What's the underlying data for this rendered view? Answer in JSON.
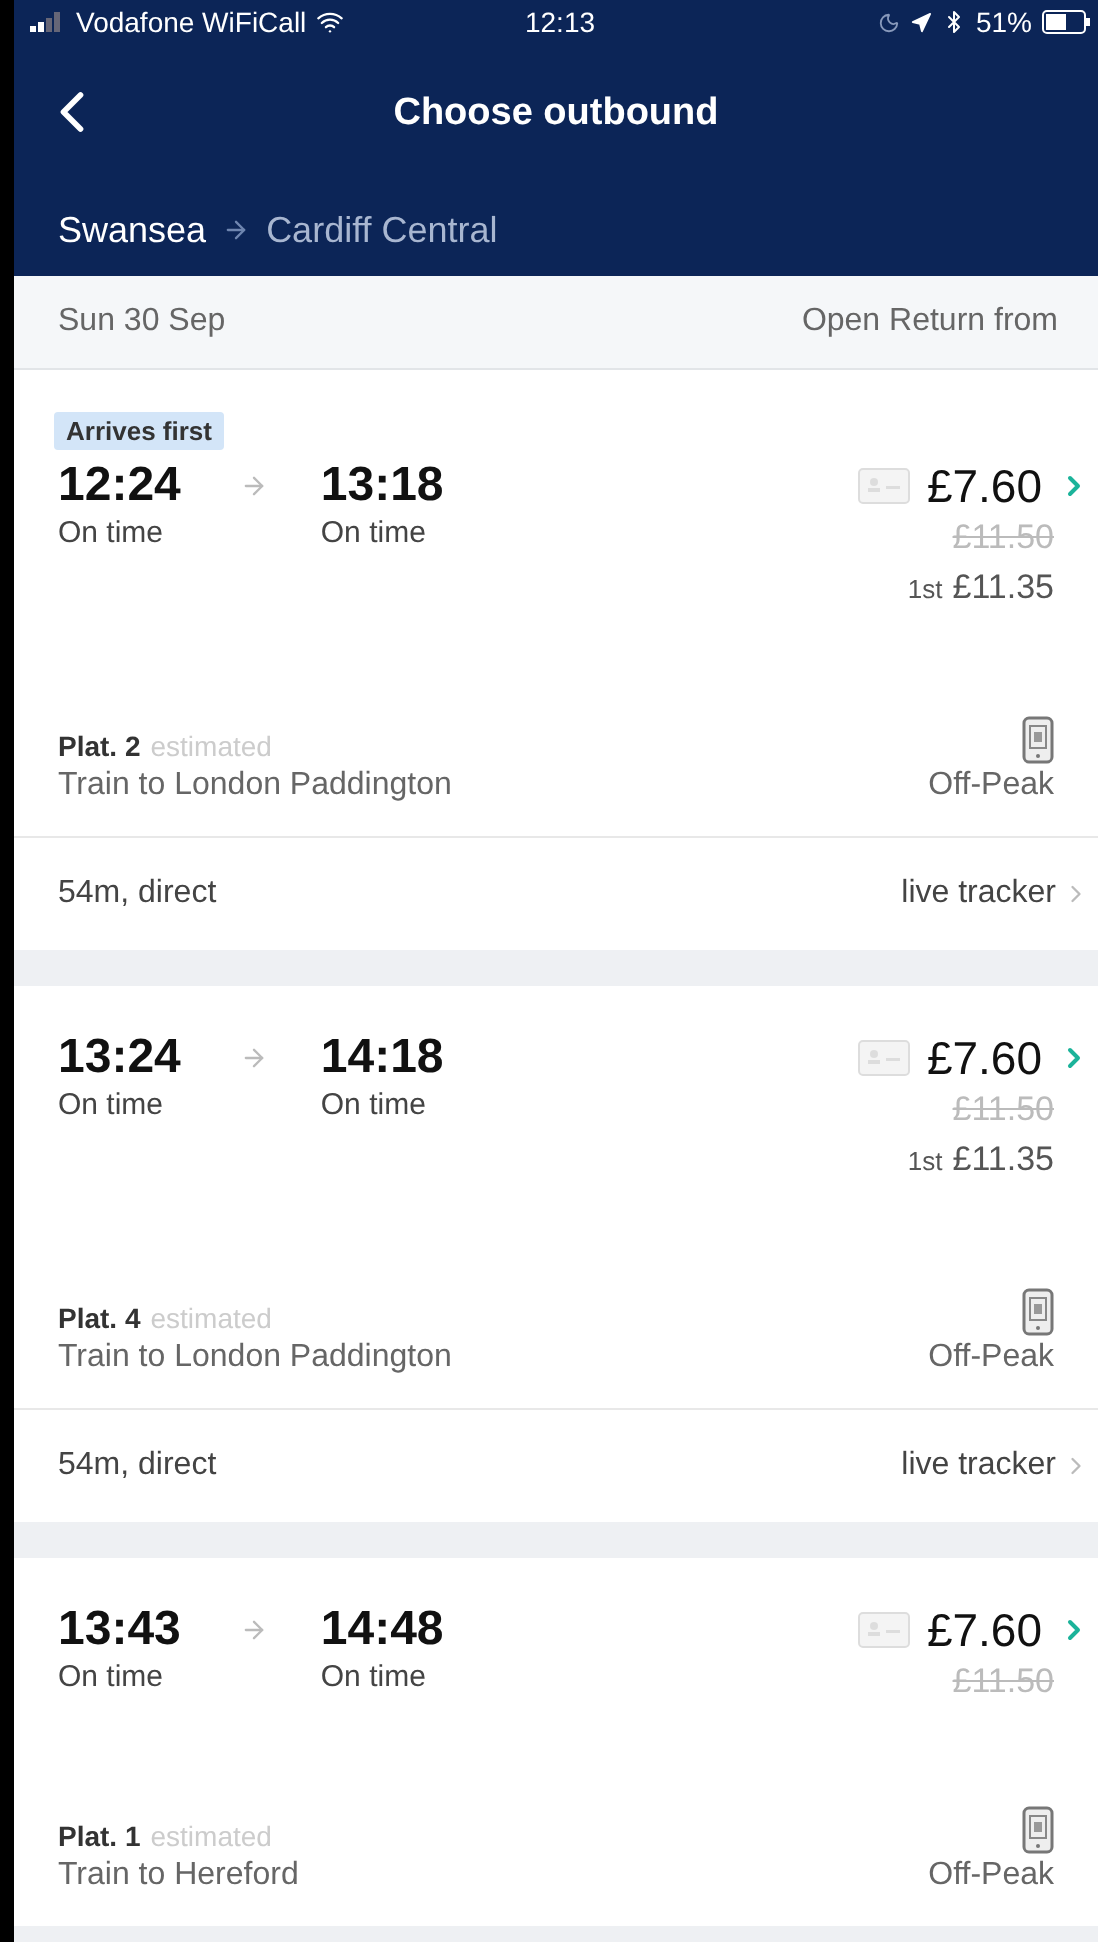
{
  "status_bar": {
    "carrier": "Vodafone WiFiCall",
    "time": "12:13",
    "battery": "51%"
  },
  "header": {
    "title": "Choose outbound"
  },
  "route": {
    "from": "Swansea",
    "to": "Cardiff Central"
  },
  "date_bar": {
    "date": "Sun 30 Sep",
    "fare_type": "Open Return from"
  },
  "journeys": [
    {
      "badge": "Arrives first",
      "depart": "12:24",
      "depart_status": "On time",
      "arrive": "13:18",
      "arrive_status": "On time",
      "price": "£7.60",
      "old_price": "£11.50",
      "first_class_label": "1st",
      "first_class_price": "£11.35",
      "platform": "Plat. 2",
      "platform_note": "estimated",
      "service": "Train to London Paddington",
      "ticket": "Off-Peak",
      "duration": "54m, direct",
      "tracker": "live tracker"
    },
    {
      "depart": "13:24",
      "depart_status": "On time",
      "arrive": "14:18",
      "arrive_status": "On time",
      "price": "£7.60",
      "old_price": "£11.50",
      "first_class_label": "1st",
      "first_class_price": "£11.35",
      "platform": "Plat. 4",
      "platform_note": "estimated",
      "service": "Train to London Paddington",
      "ticket": "Off-Peak",
      "duration": "54m, direct",
      "tracker": "live tracker"
    },
    {
      "depart": "13:43",
      "depart_status": "On time",
      "arrive": "14:48",
      "arrive_status": "On time",
      "price": "£7.60",
      "old_price": "£11.50",
      "platform": "Plat. 1",
      "platform_note": "estimated",
      "service": "Train to Hereford",
      "ticket": "Off-Peak"
    }
  ]
}
